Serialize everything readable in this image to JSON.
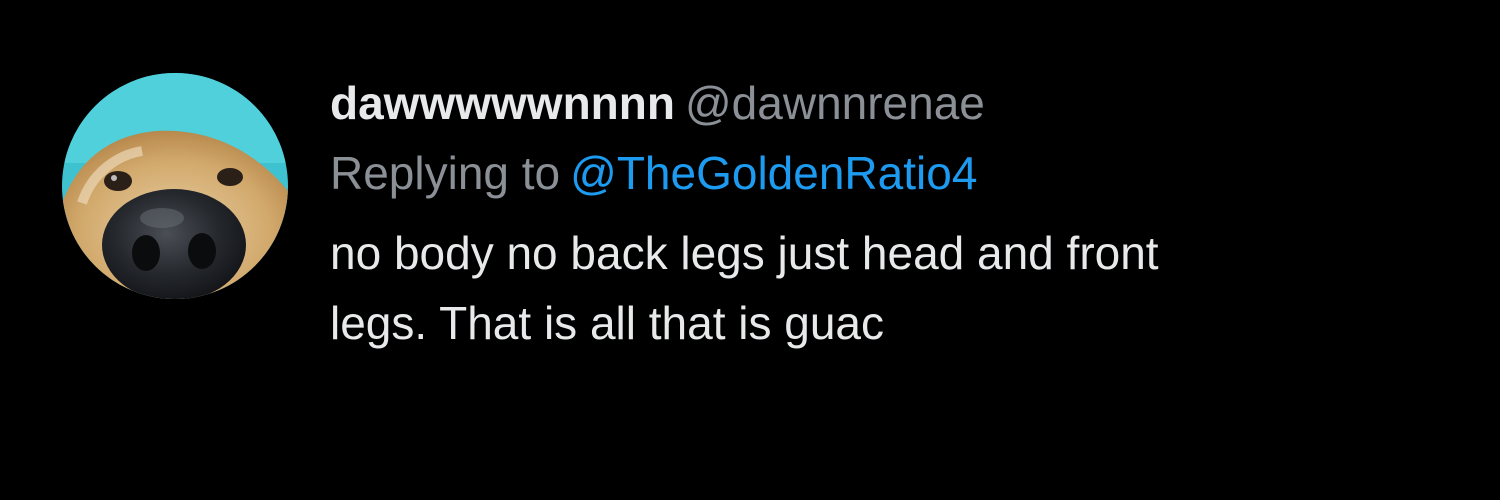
{
  "tweet": {
    "display_name": "dawwwwwnnnn",
    "handle": "@dawnnrenae",
    "reply_prefix": "Replying to",
    "reply_to": "@TheGoldenRatio4",
    "text_line_1": "no body no back legs just head and front",
    "text_line_2": "legs. That is all that is guac"
  },
  "avatar": {
    "icon": "dog-nose-avatar-icon"
  },
  "colors": {
    "background": "#000000",
    "primary_text": "#e7e9ea",
    "secondary_text": "#8b9096",
    "link": "#1d9bf0"
  }
}
